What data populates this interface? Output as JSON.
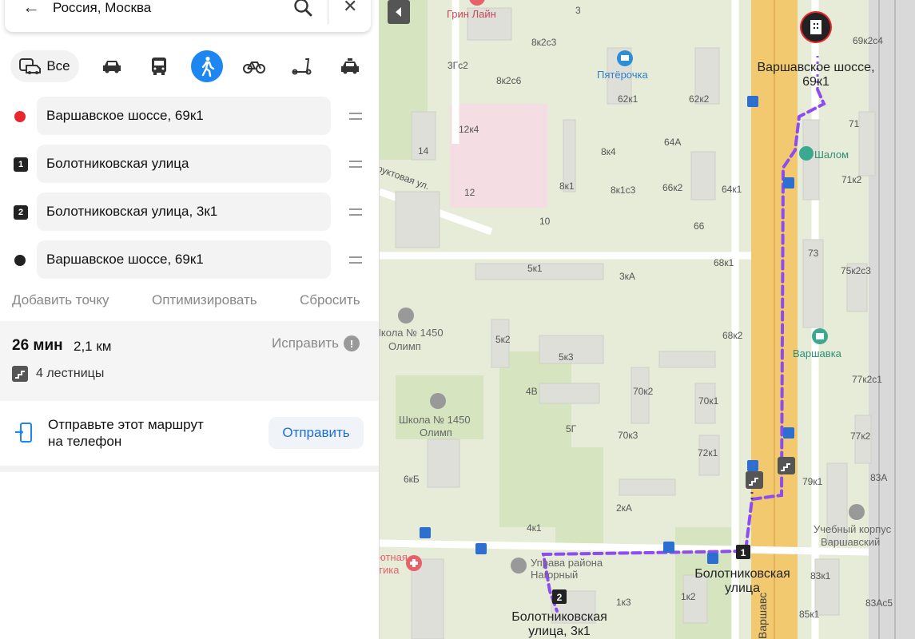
{
  "search": {
    "query": "Россия, Москва"
  },
  "modes": {
    "all_label": "Все"
  },
  "waypoints": [
    {
      "label": "Варшавское шоссе, 69к1",
      "marker": "red-dot"
    },
    {
      "label": "Болотниковская улица",
      "marker": "1"
    },
    {
      "label": "Болотниковская улица, 3к1",
      "marker": "2"
    },
    {
      "label": "Варшавское шоссе, 69к1",
      "marker": "black-dot"
    }
  ],
  "actions": {
    "add_point": "Добавить точку",
    "optimize": "Оптимизировать",
    "reset": "Сбросить"
  },
  "route": {
    "duration": "26 мин",
    "distance": "2,1 км",
    "fix": "Исправить",
    "stairs": "4 лестницы"
  },
  "send": {
    "line1": "Отправьте этот маршрут",
    "line2": "на телефон",
    "button": "Отправить"
  },
  "colors": {
    "accent": "#1d86f0",
    "route": "#8c4cf0",
    "start": "#e8262b",
    "map_bg": "#e6ecd7"
  },
  "map": {
    "pois": {
      "grin": "Грин Лайн",
      "pyat": "Пятёрочка",
      "shalom": "Шалом",
      "varshavka": "Варшавка",
      "school1": "Школа № 1450",
      "school1_b": "Олимп",
      "school2": "Школа № 1450",
      "school2_b": "Олимп",
      "uprava1": "Управа района",
      "uprava2": "Нагорный",
      "uchebny1": "Учебный корпус",
      "uchebny2": "Варшавский",
      "gutn1": "ютная",
      "gutn2": "тика"
    },
    "streets": {
      "kurut": "руктовая ул.",
      "varsh": "Варшавс"
    },
    "dest": {
      "line1": "Варшавское шоссе,",
      "line2": "69к1"
    },
    "pin1": {
      "line1": "Болотниковская",
      "line2": "улица"
    },
    "pin2": {
      "line1": "Болотниковская",
      "line2": "улица, 3к1"
    },
    "markers": {
      "one": "1",
      "two": "2"
    },
    "houses": {
      "h3": "3",
      "h8k2s3": "8к2с3",
      "h3gs2": "3Гс2",
      "h8k2s6": "8к2с6",
      "h12k4": "12к4",
      "h62k1": "62к1",
      "h62k2": "62к2",
      "h64a": "64А",
      "h8k4": "8к4",
      "h14": "14",
      "h12": "12",
      "h10": "10",
      "h8k1": "8к1",
      "h8k1s3": "8к1с3",
      "h66k2": "66к2",
      "h64k1": "64к1",
      "h66": "66",
      "h69k2s4": "69к2с4",
      "h71": "71",
      "h71k2": "71к2",
      "h73": "73",
      "h75k2s3": "75к2с3",
      "h5k1": "5к1",
      "h3ka": "3кА",
      "h68k1": "68к1",
      "h5k2": "5к2",
      "h5k3": "5к3",
      "h68k2": "68к2",
      "h4v": "4В",
      "h70k2": "70к2",
      "h70k1": "70к1",
      "h77k2s1": "77к2с1",
      "h5g": "5Г",
      "h70k3": "70к3",
      "h77k2": "77к2",
      "h72k1": "72к1",
      "h6kb": "6кБ",
      "h79k1": "79к1",
      "h83a": "83А",
      "h2ka": "2кА",
      "h4k1": "4к1",
      "h1k2": "1к2",
      "h1k3": "1к3",
      "h83k1": "83к1",
      "h85k1": "85к1",
      "h83as5": "83Ас5"
    }
  }
}
